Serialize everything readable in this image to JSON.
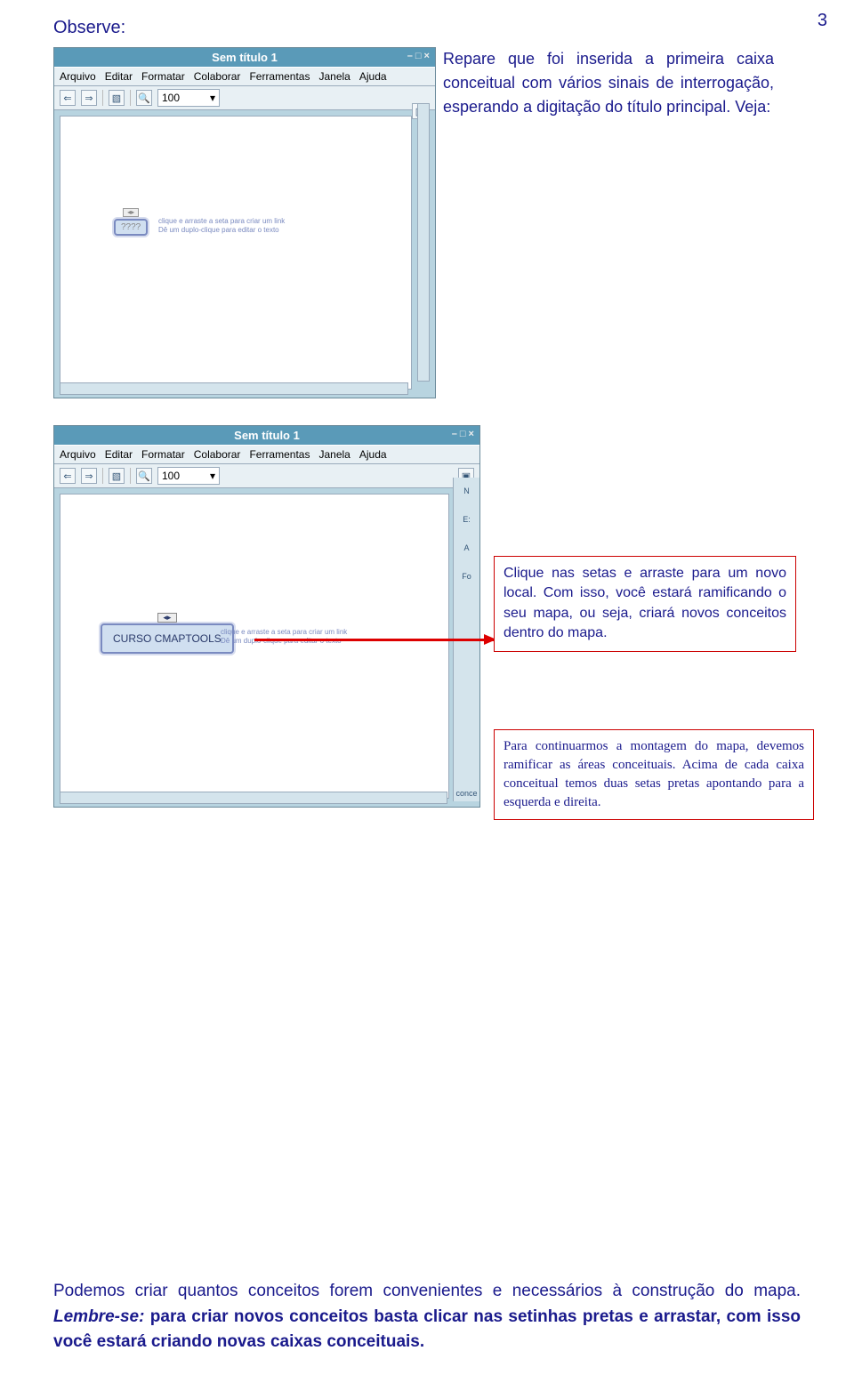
{
  "page_number": "3",
  "observe_label": "Observe:",
  "screenshot1": {
    "title": "Sem título 1",
    "menu": [
      "Arquivo",
      "Editar",
      "Formatar",
      "Colaborar",
      "Ferramentas",
      "Janela",
      "Ajuda"
    ],
    "zoom": "100",
    "concept_placeholder": "????",
    "hint_line1": "clique e arraste a seta para criar um link",
    "hint_line2": "Dê um duplo-clique para editar o texto"
  },
  "para1": "Repare que foi inserida a primeira caixa conceitual com vários sinais de interrogação, esperando a digitação do título principal. Veja:",
  "screenshot2": {
    "title": "Sem título 1",
    "menu": [
      "Arquivo",
      "Editar",
      "Formatar",
      "Colaborar",
      "Ferramentas",
      "Janela",
      "Ajuda"
    ],
    "zoom": "100",
    "concept_label": "CURSO CMAPTOOLS",
    "hint_line1": "clique e arraste a seta para criar um link",
    "hint_line2": "Dê um duplo-clique para editar o texto",
    "side_labels": [
      "N",
      "E:",
      "A",
      "Fo"
    ],
    "footer_fragment": "conce"
  },
  "callout1": "Clique nas setas e arraste para um novo local. Com isso, você estará ramificando o seu mapa, ou seja, criará novos conceitos dentro do mapa.",
  "callout2": "Para continuarmos a montagem do mapa, devemos ramificar as áreas conceituais. Acima de cada caixa conceitual temos duas setas pretas apontando para a esquerda e direita.",
  "bottom": {
    "p1a": "Podemos criar quantos conceitos forem convenientes e necessários à construção do mapa. ",
    "p1b_italic": "Lembre-se:",
    "p1c_bold": " para criar novos conceitos basta clicar nas setinhas pretas e arrastar, com isso você estará criando novas caixas conceituais."
  }
}
